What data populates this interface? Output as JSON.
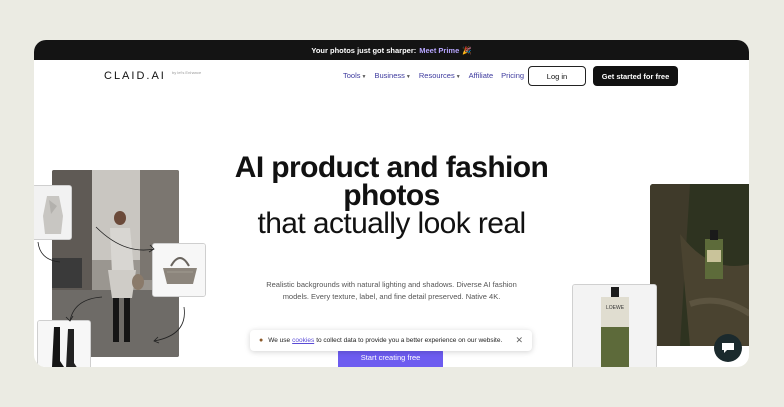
{
  "announcement": {
    "text": "Your photos just got sharper:",
    "link": "Meet Prime",
    "emoji": "🎉"
  },
  "brand": {
    "logo": "CLAID.AI",
    "logo_sub": "by let's Enhance"
  },
  "nav": {
    "items": [
      {
        "label": "Tools",
        "dropdown": true
      },
      {
        "label": "Business",
        "dropdown": true
      },
      {
        "label": "Resources",
        "dropdown": true
      },
      {
        "label": "Affiliate",
        "dropdown": false
      },
      {
        "label": "Pricing",
        "dropdown": false
      }
    ],
    "login": "Log in",
    "cta": "Get started for free",
    "chevron": "chevron-down-icon"
  },
  "hero": {
    "title_bold": "AI product and fashion photos",
    "title_light": "that actually look real",
    "subtitle": "Realistic backgrounds with natural lighting and shadows. Diverse AI fashion models. Every texture, label, and fine detail preserved. Native 4K.",
    "cta": "Start creating free"
  },
  "cookie": {
    "icon": "cookie-icon",
    "prefix": "We use",
    "link": "cookies",
    "suffix": "to collect data to provide you a better experience on our website.",
    "close": "✕"
  },
  "colors": {
    "accent": "#6d5cf0",
    "nav_link": "#3d3a9e",
    "announce_bg": "#141414",
    "page_bg": "#ebebe3"
  },
  "icons": {
    "chat": "chat-icon",
    "arrow": "curved-arrow-icon"
  }
}
